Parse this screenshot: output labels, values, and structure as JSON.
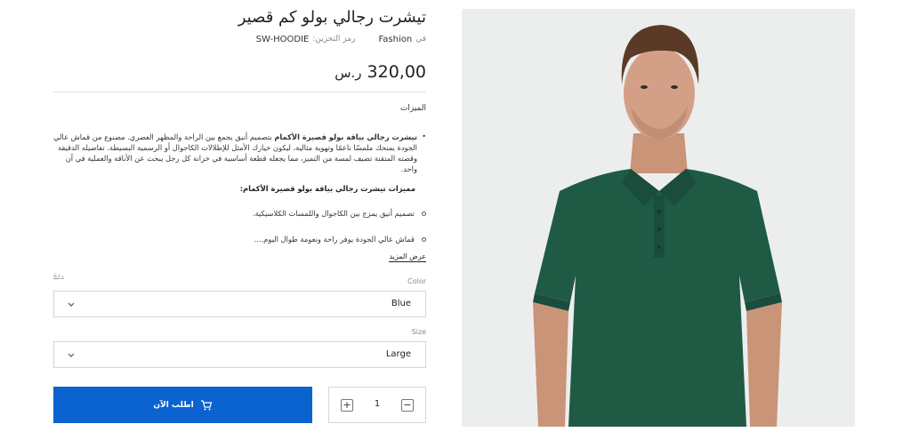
{
  "product": {
    "title": "تيشرت رجالي بولو كم قصير",
    "category_prefix": "في",
    "category": "Fashion",
    "sku_label": "رمز التخزين:",
    "sku": "SW-HOODIE",
    "price": "320,00",
    "currency": "ر.س",
    "image_alt": "man-wearing-green-polo-shirt"
  },
  "features": {
    "title": "الميزات",
    "desc_bold": "تيشرت رجالي بياقة بولو قصيرة الأكمام",
    "desc_rest": " بتصميم أنيق يجمع بين الراحة والمظهر العصري. مصنوع من قماش عالي الجودة يمنحك ملمسًا ناعمًا وتهوية مثالية، ليكون خيارك الأمثل للإطلالات الكاجوال أو الرسمية البسيطة. تفاصيله الدقيقة وقصته المتقنة تضيف لمسة من التميز، مما يجعله قطعة أساسية في خزانة كل رجل يبحث عن الأناقة والعملية في آن واحد.",
    "sub_title": "مميزات تيشرت رجالي بياقة بولو قصيرة الأكمام:",
    "items": [
      "تصميم أنيق يمزج بين الكاجوال واللمسات الكلاسيكية.",
      "قماش عالي الجودة يوفر راحة ونعومة طوال اليوم...."
    ],
    "more_label": "عرض المزيد"
  },
  "options": {
    "clear_label": "ردة",
    "color_label": "Color",
    "color_value": "Blue",
    "size_label": "Size",
    "size_value": "Large"
  },
  "cart": {
    "order_label": "اطلب الآن",
    "quantity": "1",
    "plus": "+",
    "minus": "−"
  },
  "colors": {
    "accent": "#0a63cf",
    "shirt": "#1f5a45"
  }
}
